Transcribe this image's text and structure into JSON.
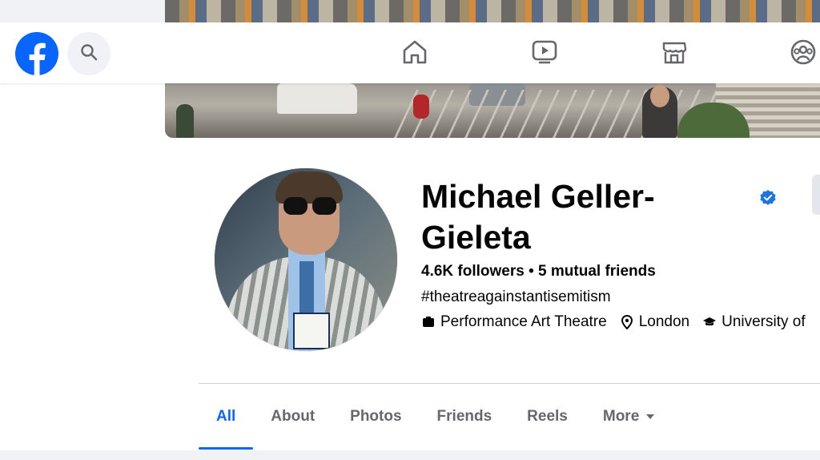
{
  "nav": {
    "logo_icon": "facebook-logo-icon",
    "search_icon": "search-icon",
    "items": [
      {
        "icon": "home-icon"
      },
      {
        "icon": "video-icon"
      },
      {
        "icon": "marketplace-icon"
      },
      {
        "icon": "groups-icon"
      }
    ]
  },
  "profile": {
    "name_line1": "Michael Geller-",
    "name_line2": "Gieleta",
    "verified_icon": "verified-badge-icon",
    "followers": "4.6K followers",
    "separator": "•",
    "mutual_friends": "5 mutual friends",
    "bio": "#theatreagainstantisemitism",
    "details": [
      {
        "icon": "category-icon",
        "text": "Performance Art Theatre"
      },
      {
        "icon": "location-pin-icon",
        "text": "London"
      },
      {
        "icon": "education-icon",
        "text": "University of"
      }
    ]
  },
  "tabs": [
    {
      "label": "All",
      "active": true
    },
    {
      "label": "About"
    },
    {
      "label": "Photos"
    },
    {
      "label": "Friends"
    },
    {
      "label": "Reels"
    },
    {
      "label": "More",
      "has_caret": true
    }
  ],
  "colors": {
    "accent": "#0866ff",
    "verified": "#1b74e4",
    "text": "#050505",
    "muted": "#65676b",
    "bg_gray": "#f0f2f5"
  }
}
